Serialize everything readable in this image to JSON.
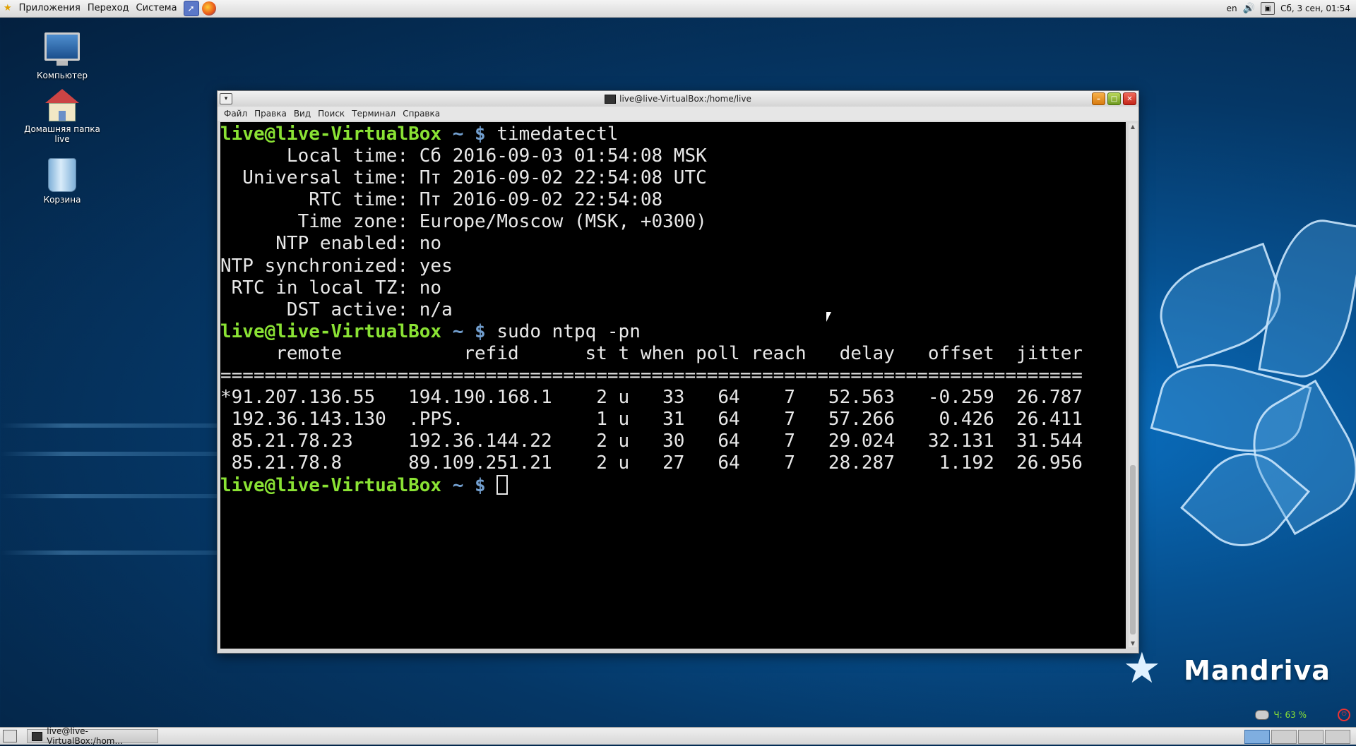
{
  "top_panel": {
    "menus": [
      "Приложения",
      "Переход",
      "Система"
    ],
    "lang": "en",
    "clock": "Сб, 3 сен, 01:54"
  },
  "desktop_icons": [
    {
      "label": "Компьютер"
    },
    {
      "label": "Домашняя папка live"
    },
    {
      "label": "Корзина"
    }
  ],
  "window": {
    "title": "live@live-VirtualBox:/home/live",
    "menu": [
      "Файл",
      "Правка",
      "Вид",
      "Поиск",
      "Терминал",
      "Справка"
    ]
  },
  "terminal": {
    "prompt_user": "live@live-VirtualBox",
    "prompt_dir": "~ $",
    "cmd1": "timedatectl",
    "timedatectl_lines": [
      "      Local time: Сб 2016-09-03 01:54:08 MSK",
      "  Universal time: Пт 2016-09-02 22:54:08 UTC",
      "        RTC time: Пт 2016-09-02 22:54:08",
      "       Time zone: Europe/Moscow (MSK, +0300)",
      "     NTP enabled: no",
      "NTP synchronized: yes",
      " RTC in local TZ: no",
      "      DST active: n/a"
    ],
    "cmd2": "sudo ntpq -pn",
    "ntpq_header": "     remote           refid      st t when poll reach   delay   offset  jitter",
    "ntpq_separator": "==============================================================================",
    "ntpq_rows": [
      "*91.207.136.55   194.190.168.1    2 u   33   64    7   52.563   -0.259  26.787",
      " 192.36.143.130  .PPS.            1 u   31   64    7   57.266    0.426  26.411",
      " 85.21.78.23     192.36.144.22    2 u   30   64    7   29.024   32.131  31.544",
      " 85.21.78.8      89.109.251.21    2 u   27   64    7   28.287    1.192  26.956"
    ]
  },
  "branding": {
    "logo": "Mandriva"
  },
  "battery": {
    "text": "Ч: 63 %"
  },
  "bottom_panel": {
    "task_label": "live@live-VirtualBox:/hom..."
  },
  "colors": {
    "prompt_user": "#8ae234",
    "prompt_dir": "#729fcf",
    "terminal_bg": "#000000"
  }
}
